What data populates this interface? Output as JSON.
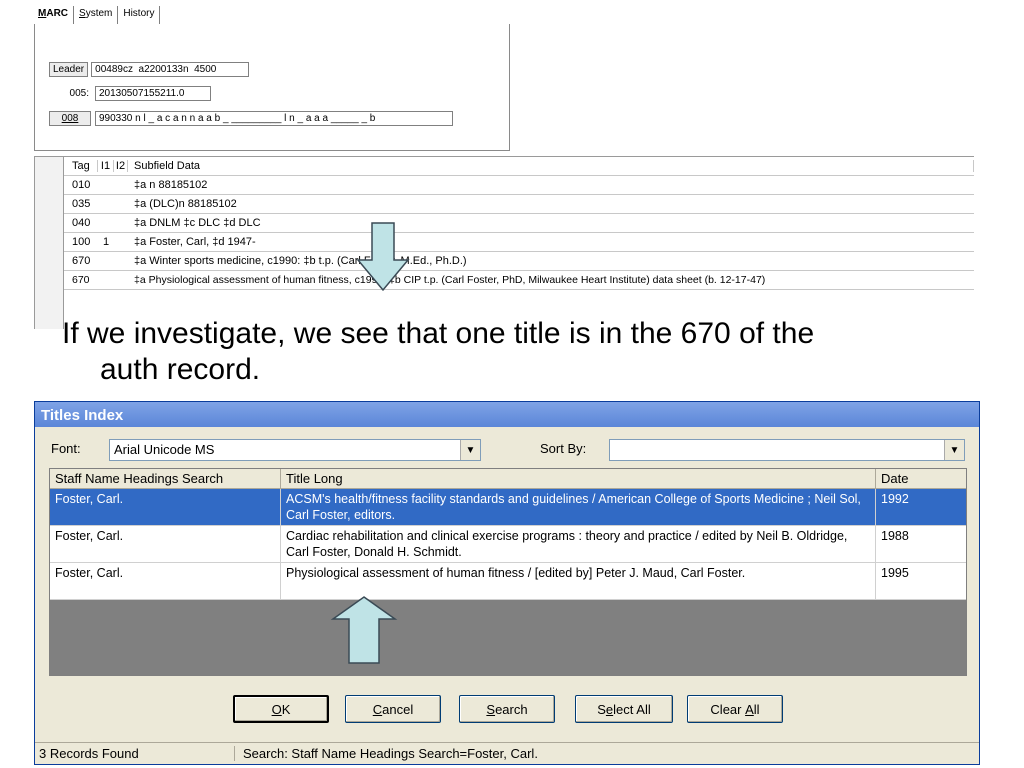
{
  "marc": {
    "tabs": [
      {
        "first": "M",
        "rest": "ARC"
      },
      {
        "first": "S",
        "rest": "ystem"
      },
      {
        "first": "",
        "rest": "History"
      }
    ],
    "leader": {
      "button": "Leader",
      "value": "00489cz  a2200133n  4500"
    },
    "f005": {
      "label": "005:",
      "value": "20130507155211.0"
    },
    "f008": {
      "button": "008",
      "value": "990330 n l _ a c a n n a a b _ _________ l n _ a a a _____ _ b"
    },
    "grid": {
      "headers": {
        "tag": "Tag",
        "i1": "I1",
        "i2": "I2",
        "sub": "Subfield Data"
      },
      "rows": [
        {
          "tag": "010",
          "i1": "",
          "i2": "",
          "sub": "‡a n  88185102"
        },
        {
          "tag": "035",
          "i1": "",
          "i2": "",
          "sub": "‡a (DLC)n  88185102"
        },
        {
          "tag": "040",
          "i1": "",
          "i2": "",
          "sub": "‡a DNLM ‡c DLC ‡d DLC"
        },
        {
          "tag": "100",
          "i1": "1",
          "i2": "",
          "sub": "‡a Foster, Carl, ‡d 1947-"
        },
        {
          "tag": "670",
          "i1": "",
          "i2": "",
          "sub": "‡a Winter sports medicine, c1990: ‡b        t.p. (Carl Foster, M.Ed., Ph.D.)"
        },
        {
          "tag": "670",
          "i1": "",
          "i2": "",
          "sub": "‡a Physiological assessment of human fitness, c1995: ‡b CIP t.p. (Carl Foster, PhD, Milwaukee Heart Institute) data sheet (b. 12-17-47)"
        }
      ]
    }
  },
  "caption": {
    "line1": "If we investigate, we see that one title is in the 670 of the",
    "line2": "auth record."
  },
  "dialog": {
    "title": "Titles Index",
    "font_label": "Font:",
    "font_value": "Arial Unicode MS",
    "sortby_label": "Sort By:",
    "sortby_value": "",
    "columns": [
      "Staff Name Headings Search",
      "Title Long",
      "Date"
    ],
    "rows": [
      {
        "name": "Foster, Carl.",
        "title": "ACSM's health/fitness facility standards and guidelines / American College of Sports Medicine ; Neil Sol, Carl Foster, editors.",
        "date": "1992",
        "selected": true
      },
      {
        "name": "Foster, Carl.",
        "title": "Cardiac rehabilitation and clinical exercise programs : theory and practice / edited by Neil B. Oldridge, Carl Foster, Donald H. Schmidt.",
        "date": "1988",
        "selected": false
      },
      {
        "name": "Foster, Carl.",
        "title": "Physiological assessment of human fitness / [edited by] Peter J. Maud, Carl Foster.",
        "date": "1995",
        "selected": false
      }
    ],
    "buttons": {
      "ok": {
        "u": "O",
        "rest": "K"
      },
      "cancel": {
        "u": "C",
        "rest": "ancel"
      },
      "search": {
        "u": "S",
        "rest": "earch"
      },
      "selectall": {
        "pre": "S",
        "u": "e",
        "rest": "lect All"
      },
      "clearall": {
        "pre": "Clear ",
        "u": "A",
        "rest": "ll"
      }
    },
    "status": {
      "count": "3 Records Found",
      "search": "Search: Staff Name Headings Search=Foster, Carl."
    }
  },
  "colors": {
    "arrow_fill": "#bfe3e6",
    "arrow_stroke": "#3a4a55",
    "selection": "#316ac5",
    "titlebar": "#6f98e0"
  }
}
